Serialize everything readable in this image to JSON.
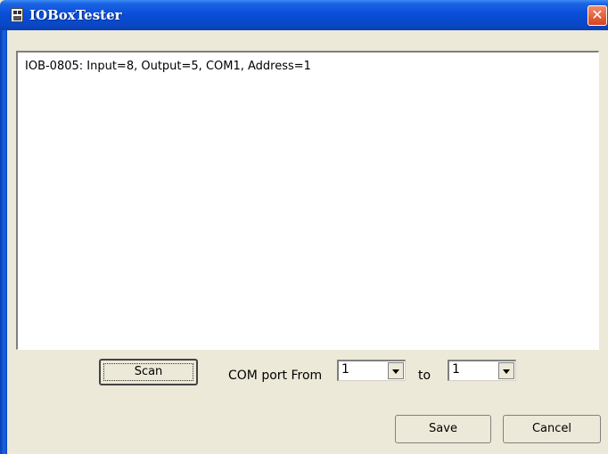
{
  "window": {
    "title": "IOBoxTester"
  },
  "output": {
    "lines": [
      "IOB-0805: Input=8, Output=5, COM1, Address=1"
    ]
  },
  "controls": {
    "scan_label": "Scan",
    "com_port_from_label": "COM port From",
    "from_value": "1",
    "to_label": "to",
    "to_value": "1"
  },
  "footer": {
    "save_label": "Save",
    "cancel_label": "Cancel"
  },
  "icons": {
    "app": "app-icon",
    "close": "close-icon",
    "dropdown": "chevron-down-icon"
  },
  "colors": {
    "titlebar": "#0a4fd9",
    "window_bg": "#ece9d8",
    "close_button": "#d6431f"
  }
}
